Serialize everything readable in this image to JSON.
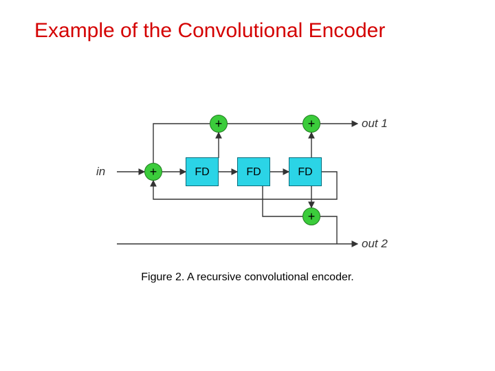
{
  "title": "Example of the Convolutional Encoder",
  "caption": "Figure 2. A recursive convolutional encoder.",
  "labels": {
    "in": "in",
    "out1": "out 1",
    "out2": "out 2"
  },
  "blocks": {
    "fd1": "FD",
    "fd2": "FD",
    "fd3": "FD"
  },
  "adders": {
    "plus": "+"
  },
  "structure": {
    "input": "in",
    "shift_registers": [
      "FD",
      "FD",
      "FD"
    ],
    "feedback_adder": "input XOR tap(FD3)",
    "output1_taps": [
      "FD1",
      "FD3"
    ],
    "output2_taps": [
      "FD2",
      "FD3"
    ],
    "recursive": true
  }
}
